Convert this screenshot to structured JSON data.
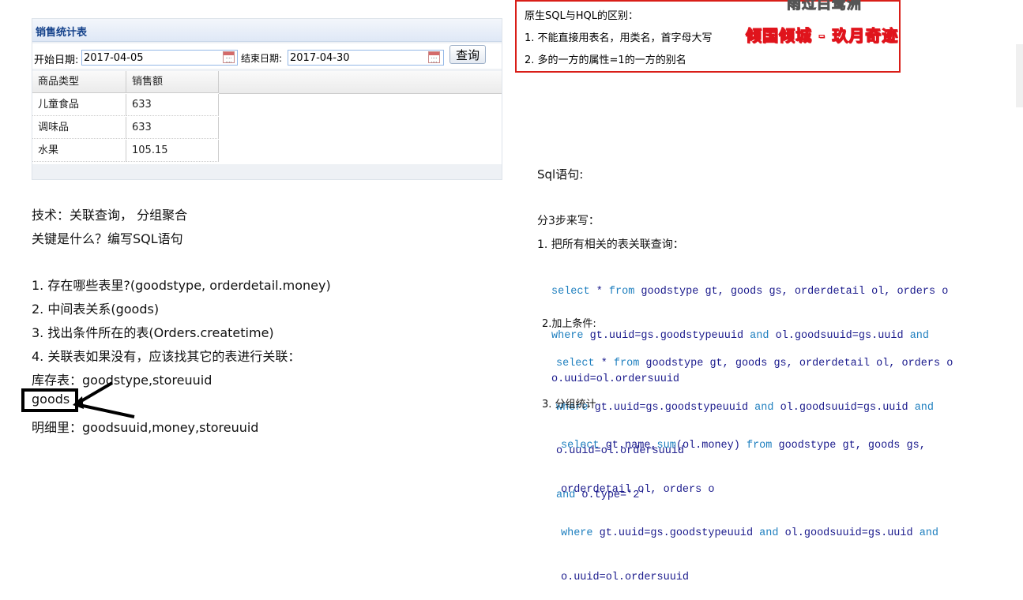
{
  "sales": {
    "title": "销售统计表",
    "start_label": "开始日期:",
    "start_value": "2017-04-05",
    "end_label": "结束日期:",
    "end_value": "2017-04-30",
    "query_label": "查询",
    "columns": [
      "商品类型",
      "销售额"
    ],
    "rows": [
      [
        "儿童食品",
        "633"
      ],
      [
        "调味品",
        "633"
      ],
      [
        "水果",
        "105.15"
      ]
    ]
  },
  "left_notes": {
    "tech": "技术：关联查询， 分组聚合",
    "key": "关键是什么？编写SQL语句",
    "step1": "1. 存在哪些表里?(goodstype, orderdetail.money)",
    "step2": "2. 中间表关系(goods)",
    "step3": "3. 找出条件所在的表(Orders.createtime)",
    "step4": "4. 关联表如果没有，应该找其它的表进行关联：",
    "stock": "库存表：goodstype,storeuuid",
    "goods": "goods",
    "detail": "明细里：goodsuuid,money,storeuuid"
  },
  "diff_box": {
    "title": "原生SQL与HQL的区别：",
    "line1": "1. 不能直接用表名，用类名，首字母大写",
    "line2": "2. 多的一方的属性=1的一方的别名",
    "watermark_top": "雨过白鹭洲",
    "watermark_main": "倾国倾城 - 玖月奇迹"
  },
  "sql": {
    "heading": "Sql语句:",
    "intro": "分3步来写：",
    "step1_title": "1. 把所有相关的表关联查询：",
    "step1_code": [
      [
        "select",
        " * ",
        "from",
        " goodstype gt, goods gs, orderdetail ol, orders o"
      ],
      [
        "where",
        " gt.uuid=gs.goodstypeuuid ",
        "and",
        " ol.goodsuuid=gs.uuid ",
        "and"
      ],
      [
        "",
        "o.uuid=ol.ordersuuid"
      ]
    ],
    "step2_title": "2.加上条件:",
    "step2_code": [
      [
        "select",
        " * ",
        "from",
        " goodstype gt, goods gs, orderdetail ol, orders o"
      ],
      [
        "where",
        " gt.uuid=gs.goodstypeuuid ",
        "and",
        " ol.goodsuuid=gs.uuid ",
        "and"
      ],
      [
        "",
        "o.uuid=ol.ordersuuid"
      ],
      [
        "and",
        " o.type='2'"
      ]
    ],
    "step3_title": "3.  分组统计",
    "step3_code": [
      [
        "select",
        " gt.name,",
        "sum",
        "(ol.money) ",
        "from",
        " goodstype gt, goods gs,"
      ],
      [
        "",
        "orderdetail ol, orders o"
      ],
      [
        "where",
        " gt.uuid=gs.goodstypeuuid ",
        "and",
        " ol.goodsuuid=gs.uuid ",
        "and"
      ],
      [
        "",
        "o.uuid=ol.ordersuuid"
      ]
    ]
  }
}
